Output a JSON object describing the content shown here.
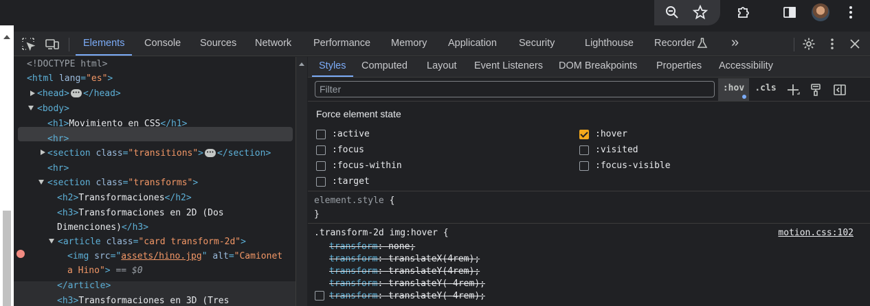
{
  "browser_toolbar": {
    "icons": [
      "zoom-icon",
      "bookmark-star-icon",
      "extensions-puzzle-icon",
      "side-panel-icon",
      "profile-avatar",
      "more-vert-icon"
    ]
  },
  "devtools": {
    "tabs": [
      {
        "label": "Elements",
        "active": true
      },
      {
        "label": "Console"
      },
      {
        "label": "Sources"
      },
      {
        "label": "Network"
      },
      {
        "label": "Performance"
      },
      {
        "label": "Memory"
      },
      {
        "label": "Application"
      },
      {
        "label": "Security"
      },
      {
        "label": "Lighthouse"
      },
      {
        "label": "Recorder"
      }
    ],
    "more_tabs": "»"
  },
  "dom": {
    "doctype": "<!DOCTYPE html>",
    "html_open": "<html",
    "html_attr_name": "lang",
    "html_attr_val": "\"es\"",
    "head_open": "<head>",
    "head_close": "</head>",
    "body_open": "<body>",
    "h1_open": "<h1>",
    "h1_text": "Movimiento en CSS",
    "h1_close": "</h1>",
    "hr": "<hr>",
    "section_open": "<section",
    "section_attr": "class",
    "section1_class": "\"transitions\"",
    "section_close": "</section>",
    "section2_class": "\"transforms\"",
    "h2_open": "<h2>",
    "h2_text": "Transformaciones",
    "h2_close": "</h2>",
    "h3_open": "<h3>",
    "h3_text_a": "Transformaciones en 2D (Dos",
    "h3_text_b": "Dimenciones)",
    "h3_close": "</h3>",
    "article_open": "<article",
    "article_class": "\"card transform-2d\"",
    "img_open": "<img",
    "img_src_attr": "src",
    "img_src": "assets/hino.jpg",
    "img_alt_attr": "alt",
    "img_alt_a": "\"Camionet",
    "img_alt_b": "a Hino\"",
    "img_close": ">",
    "eq0": "== $0",
    "article_close": "</article>",
    "h3b_text": "Transformaciones en 3D (Tres"
  },
  "styles": {
    "tabs": [
      {
        "label": "Styles",
        "active": true
      },
      {
        "label": "Computed"
      },
      {
        "label": "Layout"
      },
      {
        "label": "Event Listeners"
      },
      {
        "label": "DOM Breakpoints"
      },
      {
        "label": "Properties"
      },
      {
        "label": "Accessibility"
      }
    ],
    "filter_placeholder": "Filter",
    "hov_label": ":hov",
    "cls_label": ".cls",
    "force_state_title": "Force element state",
    "states_left": [
      {
        "label": ":active",
        "checked": false
      },
      {
        "label": ":focus",
        "checked": false
      },
      {
        "label": ":focus-within",
        "checked": false
      },
      {
        "label": ":target",
        "checked": false
      }
    ],
    "states_right": [
      {
        "label": ":hover",
        "checked": true
      },
      {
        "label": ":visited",
        "checked": false
      },
      {
        "label": ":focus-visible",
        "checked": false
      }
    ],
    "element_style_selector": "element.style",
    "open_brace": "{",
    "close_brace": "}",
    "rule_selector": ".transform-2d img:hover",
    "rule_source": "motion.css:102",
    "declarations": [
      {
        "prop": "transform",
        "value": "none;"
      },
      {
        "prop": "transform",
        "value": "translateX(4rem);"
      },
      {
        "prop": "transform",
        "value": "translateY(4rem);"
      },
      {
        "prop": "transform",
        "value": "translateY(-4rem);"
      },
      {
        "prop": "transform",
        "value": "translateY(-4rem);"
      }
    ],
    "accent_color": "#7cacf8",
    "checked_color": "#f4a91c"
  }
}
